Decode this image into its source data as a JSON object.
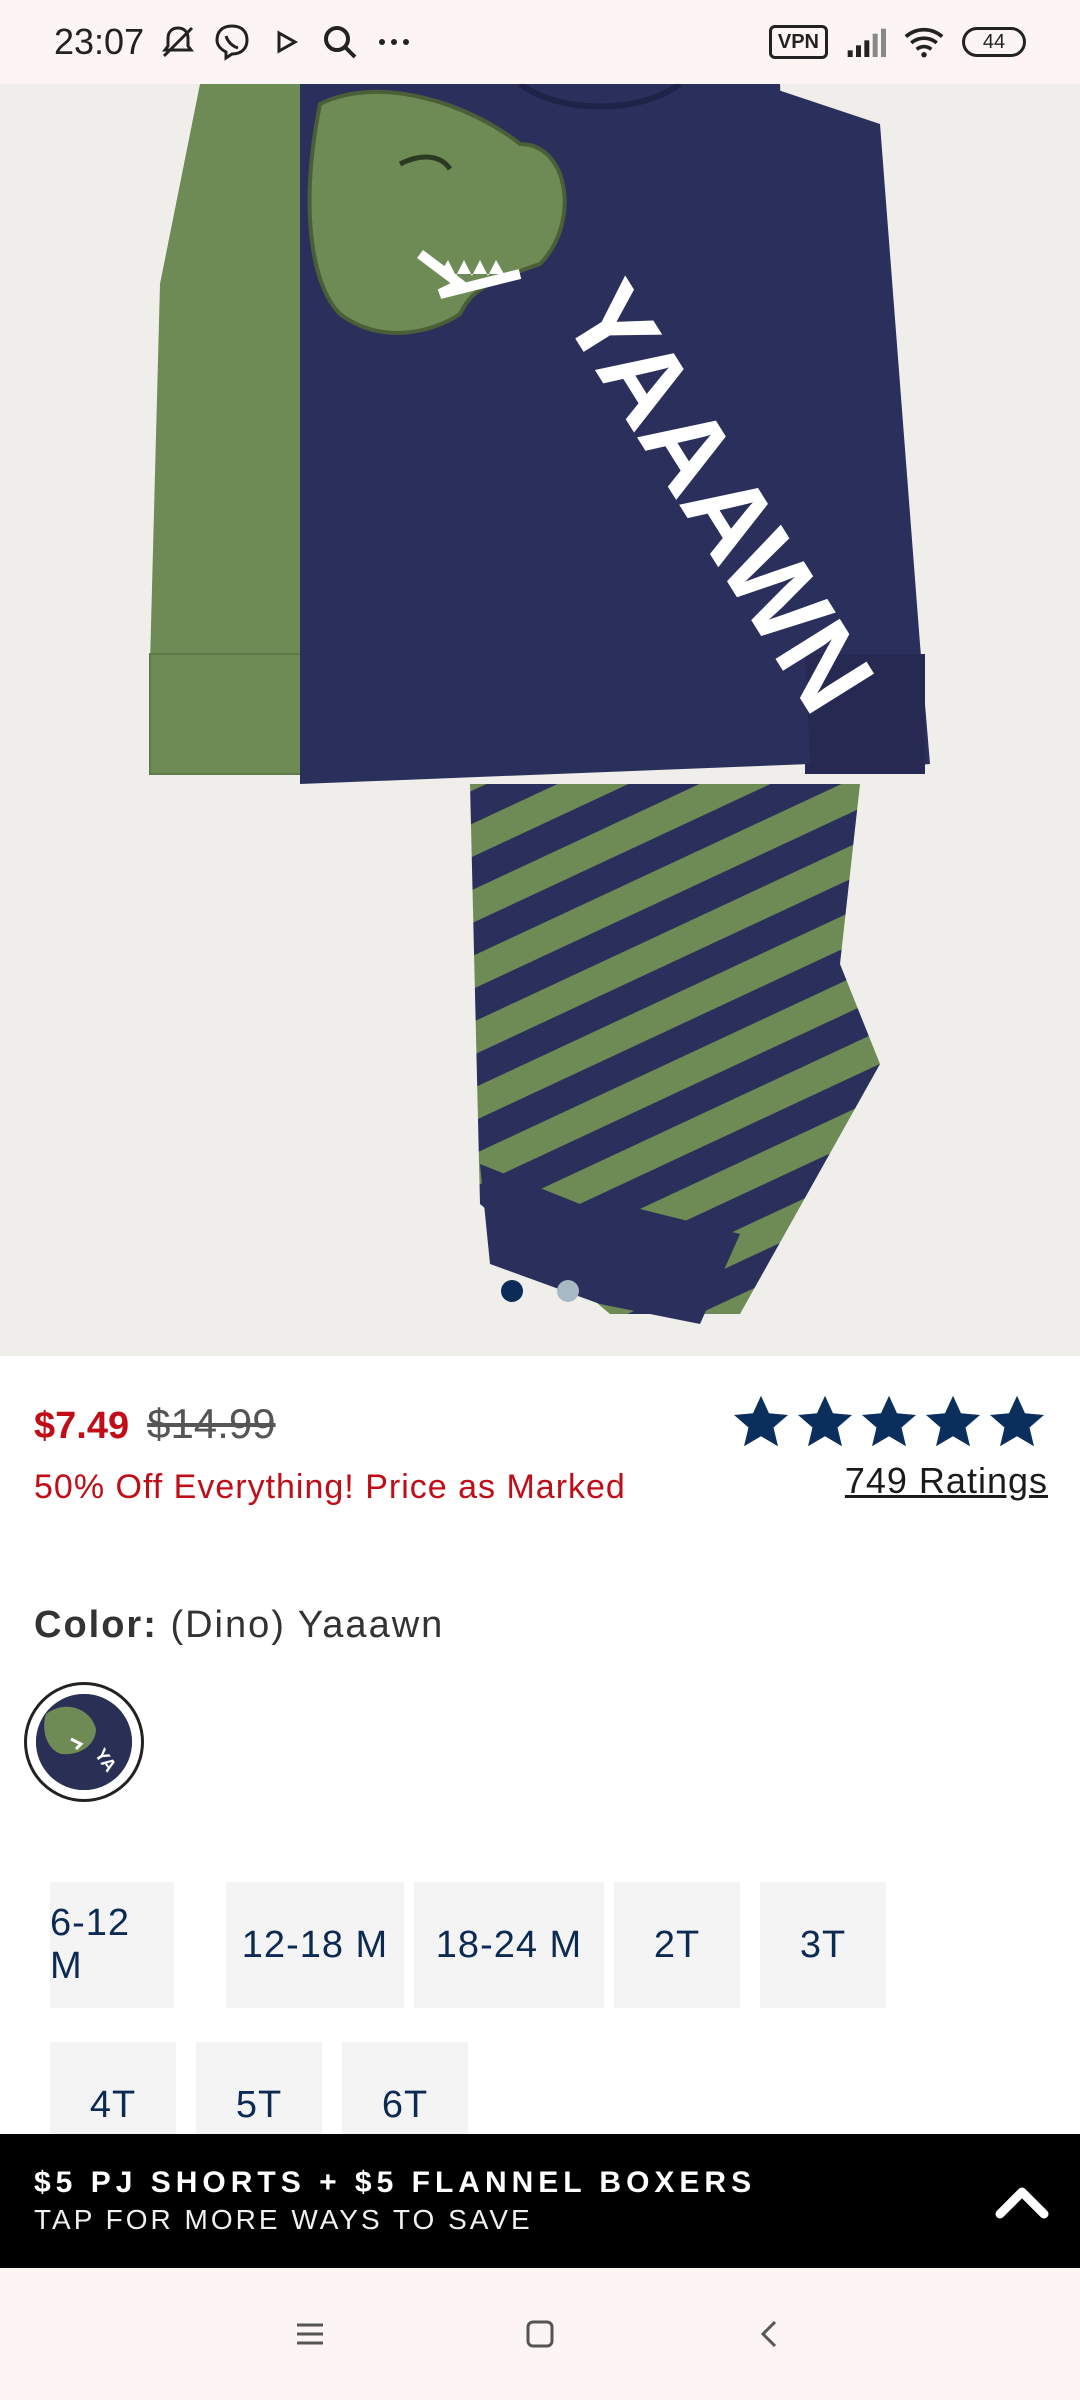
{
  "status_bar": {
    "time": "23:07",
    "vpn": "VPN",
    "battery": "44",
    "icons": [
      "mute-icon",
      "viber-icon",
      "play-icon",
      "search-icon",
      "more-icon",
      "signal-icon",
      "wifi-icon",
      "battery-icon"
    ]
  },
  "hero": {
    "print_text": "YAAAWN",
    "carousel": {
      "count": 2,
      "active": 0
    },
    "colors": {
      "navy": "#2a2f5c",
      "green": "#6e8a55",
      "background": "#efeeea"
    }
  },
  "product": {
    "sale_price": "$7.49",
    "original_price": "$14.99",
    "promo_text": "50% Off Everything! Price as Marked",
    "rating": {
      "stars": 5,
      "ratings_label": "749 Ratings"
    },
    "color_label": "Color:",
    "color_value": "(Dino) Yaaawn"
  },
  "sizes": [
    "6-12 M",
    "12-18 M",
    "18-24 M",
    "2T",
    "3T",
    "4T",
    "5T",
    "6T"
  ],
  "promo_banner": {
    "title": "$5 PJ SHORTS + $5 FLANNEL BOXERS",
    "subtitle": "TAP FOR MORE WAYS TO SAVE",
    "icon": "chevron-up-icon"
  },
  "nav_bar": {
    "icons": [
      "menu-icon",
      "home-icon",
      "back-icon"
    ]
  },
  "theme": {
    "accent_red": "#c00d17",
    "navy": "#0a2d57",
    "star_color": "#0b2f5c"
  }
}
